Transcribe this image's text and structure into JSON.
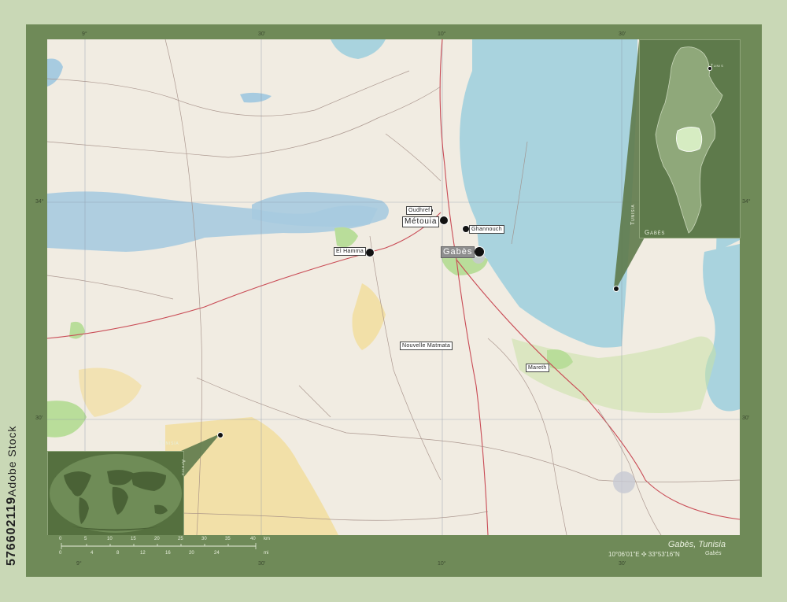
{
  "map": {
    "region_name": "Gabès, Tunisia",
    "coordinates": "10°06'01\"E ✣ 33°53'16\"N",
    "arrow_label": "Gabès",
    "cities": [
      {
        "name": "Gabès",
        "style": "capital"
      },
      {
        "name": "Métouia",
        "style": "big"
      },
      {
        "name": "El Hamma",
        "style": "normal"
      },
      {
        "name": "Oudhref",
        "style": "small"
      },
      {
        "name": "Ghannouch",
        "style": "small"
      },
      {
        "name": "Nouvelle Matmata",
        "style": "small"
      },
      {
        "name": "Mareth",
        "style": "small"
      }
    ],
    "ticks": {
      "top": [
        "9°",
        "30'",
        "10°",
        "30'"
      ],
      "bottom": [
        "9°",
        "30'",
        "10°",
        "30'"
      ],
      "left": [
        "34°",
        "30'"
      ],
      "right": [
        "34°",
        "30'"
      ]
    }
  },
  "inset_country": {
    "country_label": "Tunisia",
    "region_label": "Gabès",
    "capital_label": "Tunis"
  },
  "inset_world": {
    "country_label": "Tunisia",
    "continent_label": "Africa"
  },
  "scale": {
    "units_top": "km",
    "units_bottom": "mi",
    "ticks_km": [
      "0",
      "5",
      "10",
      "15",
      "20",
      "25",
      "30",
      "35",
      "40"
    ],
    "ticks_mi": [
      "0",
      "4",
      "8",
      "12",
      "16",
      "20",
      "24"
    ]
  },
  "watermark": {
    "stock_id": "576602119",
    "brand": "Adobe Stock"
  },
  "colors": {
    "frame": "#6f8a58",
    "land": "#f1ece2",
    "sea": "#a9d3de",
    "salt_lake": "#a7cbe0",
    "desert": "#f2e0a8",
    "green": "#b9dd9a",
    "highlight": "#c8e2a6"
  }
}
